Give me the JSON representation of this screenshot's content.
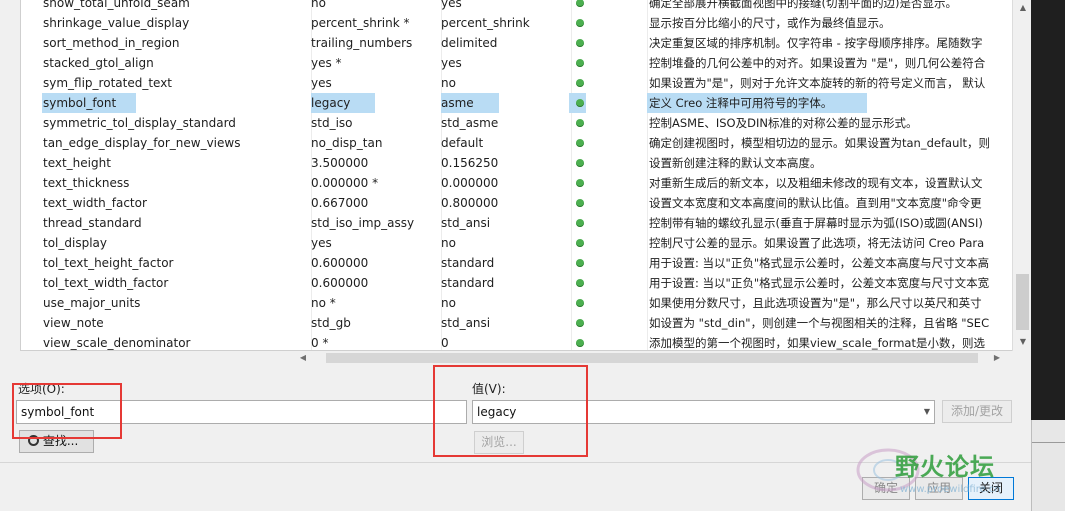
{
  "table": {
    "rows": [
      {
        "name": "show_total_unfold_seam",
        "value": "no",
        "default": "yes",
        "desc": "确定全部展开横截面视图中的接缝(切割平面的边)是否显示。",
        "selected": false
      },
      {
        "name": "shrinkage_value_display",
        "value": "percent_shrink *",
        "default": "percent_shrink",
        "desc": "显示按百分比缩小的尺寸，或作为最终值显示。",
        "selected": false
      },
      {
        "name": "sort_method_in_region",
        "value": "trailing_numbers",
        "default": "delimited",
        "desc": "决定重复区域的排序机制。仅字符串 - 按字母顺序排序。尾随数字",
        "selected": false
      },
      {
        "name": "stacked_gtol_align",
        "value": "yes *",
        "default": "yes",
        "desc": "控制堆叠的几何公差中的对齐。如果设置为 \"是\"，则几何公差符合",
        "selected": false
      },
      {
        "name": "sym_flip_rotated_text",
        "value": "yes",
        "default": "no",
        "desc": "如果设置为\"是\"，则对于允许文本旋转的新的符号定义而言， 默认",
        "selected": false
      },
      {
        "name": "symbol_font",
        "value": "legacy",
        "default": "asme",
        "desc": "定义 Creo 注释中可用符号的字体。",
        "selected": true
      },
      {
        "name": "symmetric_tol_display_standard",
        "value": "std_iso",
        "default": "std_asme",
        "desc": "控制ASME、ISO及DIN标准的对称公差的显示形式。",
        "selected": false
      },
      {
        "name": "tan_edge_display_for_new_views",
        "value": "no_disp_tan",
        "default": "default",
        "desc": "确定创建视图时，模型相切边的显示。如果设置为tan_default，则",
        "selected": false
      },
      {
        "name": "text_height",
        "value": "3.500000",
        "default": "0.156250",
        "desc": "设置新创建注释的默认文本高度。",
        "selected": false
      },
      {
        "name": "text_thickness",
        "value": "0.000000 *",
        "default": "0.000000",
        "desc": "对重新生成后的新文本，以及粗细未修改的现有文本，设置默认文",
        "selected": false
      },
      {
        "name": "text_width_factor",
        "value": "0.667000",
        "default": "0.800000",
        "desc": "设置文本宽度和文本高度间的默认比值。直到用\"文本宽度\"命令更",
        "selected": false
      },
      {
        "name": "thread_standard",
        "value": "std_iso_imp_assy",
        "default": "std_ansi",
        "desc": "控制带有轴的螺纹孔显示(垂直于屏幕时显示为弧(ISO)或圆(ANSI)",
        "selected": false
      },
      {
        "name": "tol_display",
        "value": "yes",
        "default": "no",
        "desc": "控制尺寸公差的显示。如果设置了此选项，将无法访问 Creo Para",
        "selected": false
      },
      {
        "name": "tol_text_height_factor",
        "value": "0.600000",
        "default": "standard",
        "desc": "用于设置: 当以\"正负\"格式显示公差时，公差文本高度与尺寸文本高",
        "selected": false
      },
      {
        "name": "tol_text_width_factor",
        "value": "0.600000",
        "default": "standard",
        "desc": "用于设置: 当以\"正负\"格式显示公差时，公差文本宽度与尺寸文本宽",
        "selected": false
      },
      {
        "name": "use_major_units",
        "value": "no *",
        "default": "no",
        "desc": "如果使用分数尺寸，且此选项设置为\"是\"，那么尺寸以英尺和英寸",
        "selected": false
      },
      {
        "name": "view_note",
        "value": "std_gb",
        "default": "std_ansi",
        "desc": "如设置为 \"std_din\"，则创建一个与视图相关的注释，且省略 \"SEC",
        "selected": false
      },
      {
        "name": "view_scale_denominator",
        "value": "0 *",
        "default": "0",
        "desc": "添加模型的第一个视图时，如果view_scale_format是小数，则选",
        "selected": false
      }
    ]
  },
  "option": {
    "label": "选项(O):",
    "value": "symbol_font",
    "find_label": "查找..."
  },
  "value_field": {
    "label": "值(V):",
    "value": "legacy",
    "browse_label": "浏览...",
    "add_change_label": "添加/更改"
  },
  "footer": {
    "ok_label": "确定",
    "apply_label": "应用",
    "close_label": "关闭"
  },
  "watermark": {
    "text": "野火论坛",
    "url": "www.proewildfire.cn"
  },
  "colors": {
    "selection": "#b9dcf4",
    "status_dot": "#4caf50",
    "annotation_box": "#e53935"
  }
}
